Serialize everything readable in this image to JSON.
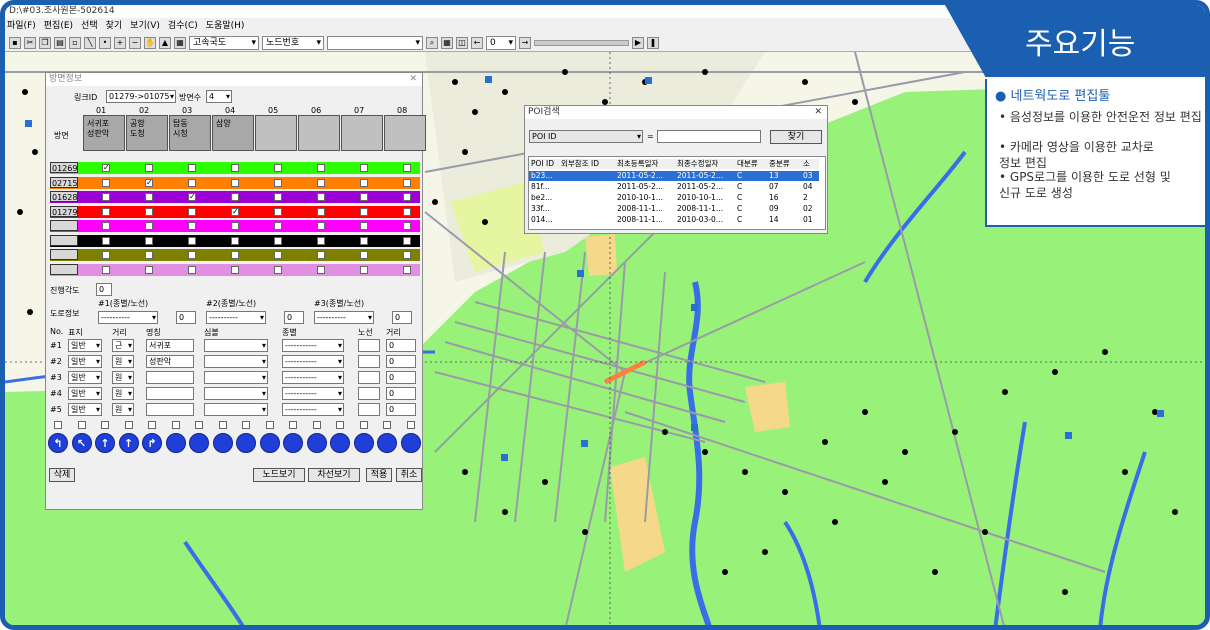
{
  "window": {
    "title": "D:\\#03.조사원본-502614"
  },
  "menu": [
    "파일(F)",
    "편집(E)",
    "선택",
    "찾기",
    "보기(V)",
    "검수(C)",
    "도움말(H)"
  ],
  "toolbar": {
    "road_type": "고속국도",
    "node_mode": "노드번호",
    "nav_value": "0"
  },
  "panel": {
    "title": "방면정보",
    "link_id_label": "링크ID",
    "link_id_value": "01279->01075",
    "dir_count_label": "방면수",
    "dir_count_value": "4",
    "row_label": "방면",
    "col_numbers": [
      "01",
      "02",
      "03",
      "04",
      "05",
      "06",
      "07",
      "08"
    ],
    "directions": [
      "서귀포\n성판악",
      "공항\n도청",
      "탑동\n시청",
      "삼양",
      "",
      "",
      "",
      ""
    ],
    "links": [
      {
        "id": "01269",
        "color": "#2bff00",
        "check": 0
      },
      {
        "id": "02715",
        "color": "#ff8000",
        "check": 1
      },
      {
        "id": "01628",
        "color": "#9b00d4",
        "check": 2
      },
      {
        "id": "01279",
        "color": "#ff0000",
        "check": 3
      },
      {
        "id": "",
        "color": "#ff00ff",
        "check": -1
      },
      {
        "id": "",
        "color": "#000000",
        "check": -1
      },
      {
        "id": "",
        "color": "#808000",
        "check": -1
      },
      {
        "id": "",
        "color": "#e090e0",
        "check": -1
      }
    ],
    "angle_label": "진행각도",
    "angle_value": "0",
    "road_info_label": "도로정보",
    "road_cols": [
      "#1(종별/노선)",
      "#2(종별/노선)",
      "#3(종별/노선)"
    ],
    "road_sel": "----------",
    "road_num": "0",
    "sign_headers": [
      "No.",
      "표지",
      "거리",
      "명칭",
      "심볼",
      "종별",
      "노선",
      "거리"
    ],
    "signs": [
      {
        "no": "#1",
        "type": "일반",
        "dist": "근",
        "name": "서귀포",
        "num": "0"
      },
      {
        "no": "#2",
        "type": "일반",
        "dist": "원",
        "name": "성판악",
        "num": "0"
      },
      {
        "no": "#3",
        "type": "일반",
        "dist": "원",
        "name": "",
        "num": "0"
      },
      {
        "no": "#4",
        "type": "일반",
        "dist": "원",
        "name": "",
        "num": "0"
      },
      {
        "no": "#5",
        "type": "일반",
        "dist": "원",
        "name": "",
        "num": "0"
      }
    ],
    "arrows": [
      "↰",
      "↖",
      "↑",
      "↑",
      "↱"
    ],
    "delete_btn": "삭제",
    "node_view_btn": "노드보기",
    "lane_view_btn": "차선보기",
    "apply_btn": "적용",
    "cancel_btn": "취소"
  },
  "poi": {
    "title": "POI검색",
    "field": "POI ID",
    "eq": "=",
    "search_btn": "찾기",
    "headers": [
      "POI ID",
      "외부참조 ID",
      "최초등록일자",
      "최종수정일자",
      "대분류",
      "중분류",
      "소"
    ],
    "rows": [
      [
        "b23...",
        "",
        "2011-05-2...",
        "2011-05-2...",
        "C",
        "13",
        "03"
      ],
      [
        "81f...",
        "",
        "2011-05-2...",
        "2011-05-2...",
        "C",
        "07",
        "04"
      ],
      [
        "be2...",
        "",
        "2010-10-1...",
        "2010-10-1...",
        "C",
        "16",
        "2"
      ],
      [
        "33f...",
        "",
        "2008-11-1...",
        "2008-11-1...",
        "C",
        "09",
        "02"
      ],
      [
        "014...",
        "",
        "2008-11-1...",
        "2010-03-0...",
        "C",
        "14",
        "01"
      ]
    ]
  },
  "features": {
    "title": "주요기능",
    "main": "네트웍도로 편집툴",
    "items": [
      "음성정보를 이용한 안전운전 정보 편집",
      "카메라 영상을 이용한 교차로\n정보 편집",
      "GPS로그를 이용한 도로 선형 및\n신규 도로 생성"
    ]
  },
  "colors": {
    "accent": "#1a5fb0",
    "map_green": "#98f27a",
    "river": "#3a6ee8"
  }
}
